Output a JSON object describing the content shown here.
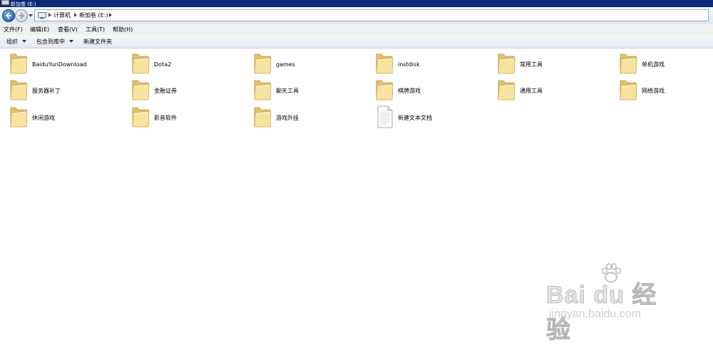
{
  "window": {
    "title": "新加卷 (E:)"
  },
  "addressbar": {
    "crumbs": [
      "计算机",
      "新加卷 (E:)"
    ]
  },
  "menubar": {
    "items": [
      "文件(F)",
      "编辑(E)",
      "查看(V)",
      "工具(T)",
      "帮助(H)"
    ]
  },
  "commandbar": {
    "organize": "组织",
    "include_in_library": "包含到库中",
    "new_folder": "新建文件夹"
  },
  "files": [
    {
      "name": "BaiduYunDownload",
      "icon": "folder-icon"
    },
    {
      "name": "Dota2",
      "icon": "folder-icon"
    },
    {
      "name": "games",
      "icon": "folder-icon"
    },
    {
      "name": "instdisk",
      "icon": "folder-icon"
    },
    {
      "name": "常用工具",
      "icon": "folder-icon"
    },
    {
      "name": "单机游戏",
      "icon": "folder-icon"
    },
    {
      "name": "服务器补丁",
      "icon": "folder-icon"
    },
    {
      "name": "金融证券",
      "icon": "folder-icon"
    },
    {
      "name": "聊天工具",
      "icon": "folder-icon"
    },
    {
      "name": "棋牌游戏",
      "icon": "folder-icon"
    },
    {
      "name": "通用工具",
      "icon": "folder-icon"
    },
    {
      "name": "网络游戏",
      "icon": "folder-icon"
    },
    {
      "name": "休闲游戏",
      "icon": "folder-icon"
    },
    {
      "name": "影音软件",
      "icon": "folder-icon"
    },
    {
      "name": "游戏外挂",
      "icon": "folder-icon"
    },
    {
      "name": "新建文本文档",
      "icon": "text-document-icon"
    }
  ],
  "watermark": {
    "brand": "Bai du 经验",
    "url": "jingyan.baidu.com"
  }
}
